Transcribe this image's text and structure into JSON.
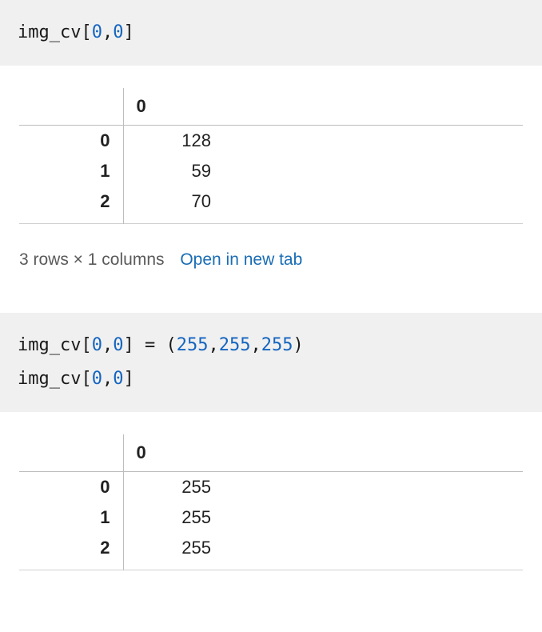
{
  "cell1": {
    "code": {
      "p1": "img_cv",
      "p2": "[",
      "p3": "0",
      "p4": ",",
      "p5": "0",
      "p6": "]"
    },
    "table": {
      "col_header": "0",
      "rows": [
        {
          "idx": "0",
          "val": "128"
        },
        {
          "idx": "1",
          "val": "59"
        },
        {
          "idx": "2",
          "val": "70"
        }
      ]
    },
    "summary_text": "3 rows × 1 columns",
    "link_text": "Open in new tab"
  },
  "cell2": {
    "code": {
      "l1p1": "img_cv",
      "l1p2": "[",
      "l1p3": "0",
      "l1p4": ",",
      "l1p5": "0",
      "l1p6": "]",
      "l1p7": " = (",
      "l1p8": "255",
      "l1p9": ",",
      "l1p10": "255",
      "l1p11": ",",
      "l1p12": "255",
      "l1p13": ")",
      "l2p1": "img_cv",
      "l2p2": "[",
      "l2p3": "0",
      "l2p4": ",",
      "l2p5": "0",
      "l2p6": "]"
    },
    "table": {
      "col_header": "0",
      "rows": [
        {
          "idx": "0",
          "val": "255"
        },
        {
          "idx": "1",
          "val": "255"
        },
        {
          "idx": "2",
          "val": "255"
        }
      ]
    }
  }
}
